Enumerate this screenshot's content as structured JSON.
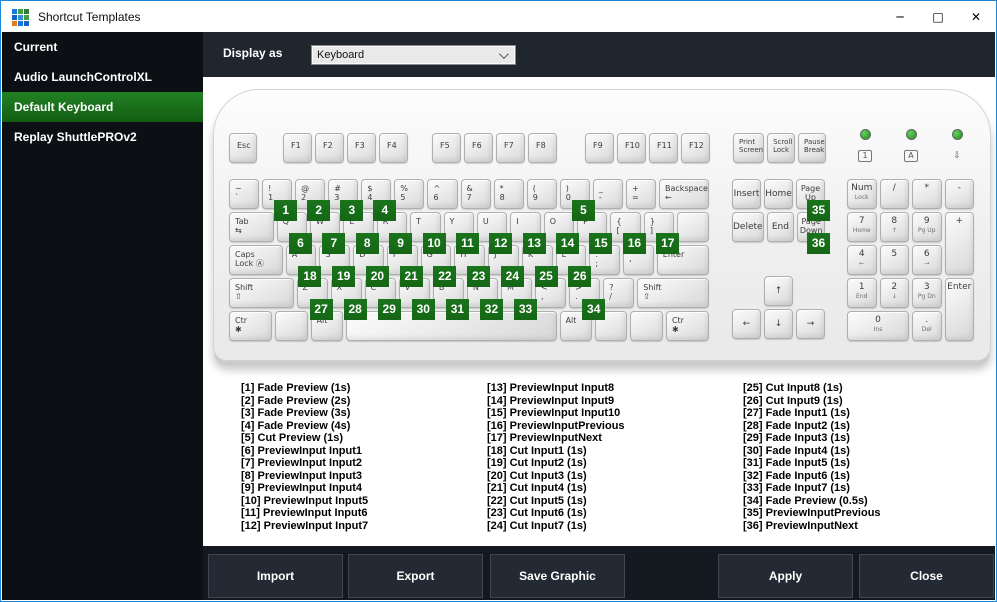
{
  "window": {
    "title": "Shortcut Templates",
    "icon_colors": [
      "#1a7ad9",
      "#43a047",
      "#2e7d32",
      "#1565c0",
      "#2f8fd9",
      "#43a047",
      "#e07d20",
      "#1a7ad9",
      "#1565c0"
    ],
    "controls": [
      {
        "name": "minimize",
        "glyph": "─"
      },
      {
        "name": "maximize",
        "glyph": "□"
      },
      {
        "name": "close",
        "glyph": "✕"
      }
    ]
  },
  "sidebar": {
    "items": [
      {
        "label": "Current",
        "selected": false
      },
      {
        "label": "Audio LaunchControlXL",
        "selected": false
      },
      {
        "label": "Default Keyboard",
        "selected": true
      },
      {
        "label": "Replay ShuttlePROv2",
        "selected": false
      }
    ]
  },
  "toolbar": {
    "display_as_label": "Display as",
    "display_as_value": "Keyboard"
  },
  "colors": {
    "accent_green": "#156615",
    "sidebar_selected": "#1b7a1b",
    "dark_panel": "#20262d",
    "footer": "#14191f"
  },
  "keyboard": {
    "esc": [
      {
        "t": "Esc",
        "cls": "fk"
      }
    ],
    "fgroups": [
      [
        {
          "t": "F1",
          "cls": "fk"
        },
        {
          "t": "F2",
          "cls": "fk"
        },
        {
          "t": "F3",
          "cls": "fk"
        },
        {
          "t": "F4",
          "cls": "fk"
        }
      ],
      [
        {
          "t": "F5",
          "cls": "fk"
        },
        {
          "t": "F6",
          "cls": "fk"
        },
        {
          "t": "F7",
          "cls": "fk"
        },
        {
          "t": "F8",
          "cls": "fk"
        }
      ],
      [
        {
          "t": "F9",
          "cls": "fk"
        },
        {
          "t": "F10",
          "cls": "fk"
        },
        {
          "t": "F11",
          "cls": "fk"
        },
        {
          "t": "F12",
          "cls": "fk"
        }
      ]
    ],
    "sysgroup": [
      {
        "t": "Print",
        "b": "Screen",
        "cls": "sys"
      },
      {
        "t": "Scroll",
        "b": "Lock",
        "cls": "sys"
      },
      {
        "t": "Pause",
        "b": "Break",
        "cls": "sys"
      }
    ],
    "leds": [
      {
        "label": "1",
        "style": "boxed",
        "name": "numlock-led"
      },
      {
        "label": "A",
        "style": "boxed",
        "name": "capslock-led"
      },
      {
        "label": "⇩",
        "style": "plain",
        "name": "scrolllock-led"
      }
    ],
    "main_rows": [
      [
        {
          "t": "~",
          "b": "`"
        },
        {
          "t": "!",
          "b": "1",
          "n": 1
        },
        {
          "t": "@",
          "b": "2",
          "n": 2
        },
        {
          "t": "#",
          "b": "3",
          "n": 3
        },
        {
          "t": "$",
          "b": "4",
          "n": 4
        },
        {
          "t": "%",
          "b": "5"
        },
        {
          "t": "^",
          "b": "6"
        },
        {
          "t": "&",
          "b": "7"
        },
        {
          "t": "*",
          "b": "8"
        },
        {
          "t": "(",
          "b": "9"
        },
        {
          "t": ")",
          "b": "0",
          "n": 5
        },
        {
          "t": "_",
          "b": "-"
        },
        {
          "t": "+",
          "b": "="
        },
        {
          "t": "Backspace",
          "b": "←",
          "w": 1.55,
          "id": "backspace"
        }
      ],
      [
        {
          "t": "Tab",
          "b": "⇆",
          "w": 1.5,
          "id": "tab"
        },
        {
          "t": "Q",
          "n": 6
        },
        {
          "t": "W",
          "n": 7
        },
        {
          "t": "E",
          "n": 8
        },
        {
          "t": "R",
          "n": 9
        },
        {
          "t": "T",
          "n": 10
        },
        {
          "t": "Y",
          "n": 11
        },
        {
          "t": "U",
          "n": 12
        },
        {
          "t": "I",
          "n": 13
        },
        {
          "t": "O",
          "n": 14
        },
        {
          "t": "P",
          "n": 15
        },
        {
          "t": "{",
          "b": "[",
          "n": 16
        },
        {
          "t": "}",
          "b": "]",
          "n": 17
        },
        {
          "t": "",
          "w": 1.05,
          "id": "enter-top"
        }
      ],
      [
        {
          "t": "Caps",
          "b": "Lock Ⓐ",
          "w": 1.8,
          "id": "caps-lock"
        },
        {
          "t": "A",
          "n": 18
        },
        {
          "t": "S",
          "n": 19
        },
        {
          "t": "D",
          "n": 20
        },
        {
          "t": "F",
          "n": 21
        },
        {
          "t": "G",
          "n": 22
        },
        {
          "t": "H",
          "n": 23
        },
        {
          "t": "J",
          "n": 24
        },
        {
          "t": "K",
          "n": 25
        },
        {
          "t": "L",
          "n": 26
        },
        {
          "t": ":",
          "b": ";"
        },
        {
          "t": "\"",
          "b": "'"
        },
        {
          "t": "Enter",
          "w": 1.75,
          "id": "enter"
        }
      ],
      [
        {
          "t": "Shift",
          "b": "⇧",
          "w": 2.15,
          "id": "left-shift"
        },
        {
          "t": "Z",
          "n": 27
        },
        {
          "t": "X",
          "n": 28
        },
        {
          "t": "C",
          "n": 29
        },
        {
          "t": "V",
          "n": 30
        },
        {
          "t": "B",
          "n": 31
        },
        {
          "t": "N",
          "n": 32
        },
        {
          "t": "M",
          "n": 33
        },
        {
          "t": "<",
          "b": ","
        },
        {
          "t": ">",
          "b": ".",
          "n": 34
        },
        {
          "t": "?",
          "b": "/"
        },
        {
          "t": "Shift",
          "b": "⇧",
          "w": 2.4,
          "id": "right-shift"
        }
      ],
      [
        {
          "t": "Ctr",
          "b": "✱",
          "w": 1.35,
          "id": "left-ctrl"
        },
        {
          "t": "",
          "id": "blank"
        },
        {
          "t": "Alt",
          "id": "left-alt"
        },
        {
          "t": "",
          "w": 6.85,
          "id": "space"
        },
        {
          "t": "Alt",
          "id": "right-alt"
        },
        {
          "t": "",
          "id": "blank"
        },
        {
          "t": "",
          "id": "blank"
        },
        {
          "t": "Ctr",
          "b": "✱",
          "w": 1.35,
          "id": "right-ctrl"
        }
      ]
    ],
    "nav_rows": [
      [
        {
          "t": "Insert",
          "cls": "mid"
        },
        {
          "t": "Home",
          "cls": "mid"
        },
        {
          "t": "Page",
          "b": "Up",
          "cls": "c",
          "n": 35,
          "id": "page-up"
        }
      ],
      [
        {
          "t": "Delete",
          "cls": "mid"
        },
        {
          "t": "End",
          "cls": "mid"
        },
        {
          "t": "Page",
          "b": "Down",
          "cls": "c",
          "n": 36,
          "id": "page-down"
        }
      ]
    ],
    "arrow_up": [
      {
        "t": "↑",
        "cls": "mid",
        "id": "arrow-up"
      }
    ],
    "arrow_row": [
      {
        "t": "←",
        "cls": "mid",
        "id": "arrow-left"
      },
      {
        "t": "↓",
        "cls": "mid",
        "id": "arrow-down"
      },
      {
        "t": "→",
        "cls": "mid",
        "id": "arrow-right"
      }
    ],
    "numpad": [
      {
        "c": 0,
        "r": 0,
        "t": "Num",
        "b": "Lock",
        "id": "num-lock"
      },
      {
        "c": 1,
        "r": 0,
        "t": "/"
      },
      {
        "c": 2,
        "r": 0,
        "t": "*"
      },
      {
        "c": 3,
        "r": 0,
        "t": "-"
      },
      {
        "c": 0,
        "r": 1,
        "t": "7",
        "b": "Home"
      },
      {
        "c": 1,
        "r": 1,
        "t": "8",
        "b": "↑"
      },
      {
        "c": 2,
        "r": 1,
        "t": "9",
        "b": "Pg Up"
      },
      {
        "c": 3,
        "r": 1,
        "rs": 2,
        "t": "+"
      },
      {
        "c": 0,
        "r": 2,
        "t": "4",
        "b": "←"
      },
      {
        "c": 1,
        "r": 2,
        "t": "5"
      },
      {
        "c": 2,
        "r": 2,
        "t": "6",
        "b": "→"
      },
      {
        "c": 0,
        "r": 3,
        "t": "1",
        "b": "End"
      },
      {
        "c": 1,
        "r": 3,
        "t": "2",
        "b": "↓"
      },
      {
        "c": 2,
        "r": 3,
        "t": "3",
        "b": "Pg Dn"
      },
      {
        "c": 3,
        "r": 3,
        "rs": 2,
        "t": "Enter",
        "id": "numpad-enter"
      },
      {
        "c": 0,
        "r": 4,
        "cs": 2,
        "t": "0",
        "b": "Ins"
      },
      {
        "c": 2,
        "r": 4,
        "t": ".",
        "b": "Del"
      }
    ]
  },
  "legend": {
    "columns": [
      [
        "[1] Fade Preview (1s)",
        "[2] Fade Preview (2s)",
        "[3] Fade Preview (3s)",
        "[4] Fade Preview (4s)",
        "[5] Cut Preview (1s)",
        "[6] PreviewInput Input1",
        "[7] PreviewInput Input2",
        "[8] PreviewInput Input3",
        "[9] PreviewInput Input4",
        "[10] PreviewInput Input5",
        "[11] PreviewInput Input6",
        "[12] PreviewInput Input7"
      ],
      [
        "[13] PreviewInput Input8",
        "[14] PreviewInput Input9",
        "[15] PreviewInput Input10",
        "[16] PreviewInputPrevious",
        "[17] PreviewInputNext",
        "[18] Cut Input1 (1s)",
        "[19] Cut Input2 (1s)",
        "[20] Cut Input3 (1s)",
        "[21] Cut Input4 (1s)",
        "[22] Cut Input5 (1s)",
        "[23] Cut Input6 (1s)",
        "[24] Cut Input7 (1s)"
      ],
      [
        "[25] Cut Input8 (1s)",
        "[26] Cut Input9 (1s)",
        "[27] Fade Input1 (1s)",
        "[28] Fade Input2 (1s)",
        "[29] Fade Input3 (1s)",
        "[30] Fade Input4 (1s)",
        "[31] Fade Input5 (1s)",
        "[32] Fade Input6 (1s)",
        "[33] Fade Input7 (1s)",
        "[34] Fade Preview (0.5s)",
        "[35] PreviewInputPrevious",
        "[36] PreviewInputNext"
      ]
    ]
  },
  "footer": {
    "left_buttons": [
      "Import",
      "Export",
      "Save Graphic"
    ],
    "right_buttons": [
      "Apply",
      "Close"
    ],
    "left_positions": [
      5,
      145,
      287
    ],
    "right_positions": [
      515,
      656
    ]
  }
}
